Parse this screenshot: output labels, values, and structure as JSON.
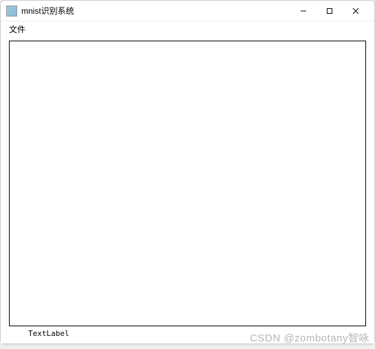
{
  "window": {
    "title": "mnist识别系统"
  },
  "menubar": {
    "items": [
      {
        "label": "文件"
      }
    ]
  },
  "main": {
    "text_label": "TextLabel"
  },
  "watermark": "CSDN @zombotany智咏"
}
